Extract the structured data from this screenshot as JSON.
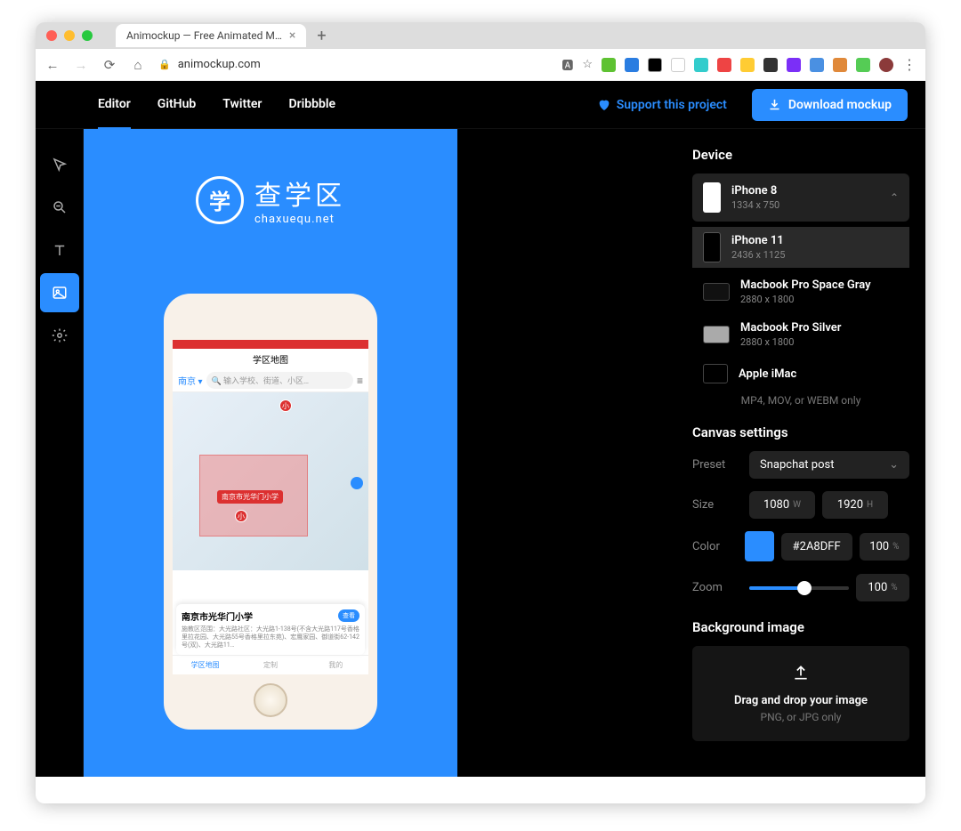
{
  "browser": {
    "tab_title": "Animockup — Free Animated M…",
    "url": "animockup.com"
  },
  "nav": {
    "items": [
      "Editor",
      "GitHub",
      "Twitter",
      "Dribbble"
    ],
    "support": "Support this project",
    "download": "Download mockup"
  },
  "canvas": {
    "brand_title": "查学区",
    "brand_sub": "chaxuequ.net",
    "brand_glyph": "学",
    "phone": {
      "title": "学区地图",
      "city": "南京",
      "search_placeholder": "输入学校、街道、小区…",
      "marker": "南京市光华门小学",
      "pin": "小",
      "card_title": "南京市光华门小学",
      "card_tag": "查看",
      "card_desc": "施教区范围：大光路社区：大光路1-138号(不含大光路117号香格里拉花园、大光路55号香格里拉东苑)、宏鹰家园、御道街62-142号(双)、大光路11…",
      "bottom": [
        "学区地图",
        "定制",
        "我的"
      ]
    }
  },
  "panel": {
    "device_h": "Device",
    "devices": [
      {
        "name": "iPhone 8",
        "res": "1334 x 750"
      },
      {
        "name": "iPhone 11",
        "res": "2436 x 1125"
      },
      {
        "name": "Macbook Pro Space Gray",
        "res": "2880 x 1800"
      },
      {
        "name": "Macbook Pro Silver",
        "res": "2880 x 1800"
      },
      {
        "name": "Apple iMac",
        "res": ""
      }
    ],
    "video_hint": "MP4, MOV, or WEBM only",
    "canvas_h": "Canvas settings",
    "preset_l": "Preset",
    "preset_v": "Snapchat post",
    "size_l": "Size",
    "size_w": "1080",
    "size_h": "1920",
    "w": "W",
    "h": "H",
    "color_l": "Color",
    "color_v": "#2A8DFF",
    "color_a": "100",
    "pct": "%",
    "zoom_l": "Zoom",
    "zoom_v": "100",
    "bg_h": "Background image",
    "bg_drop": "Drag and drop your image",
    "bg_hint": "PNG, or JPG only"
  }
}
